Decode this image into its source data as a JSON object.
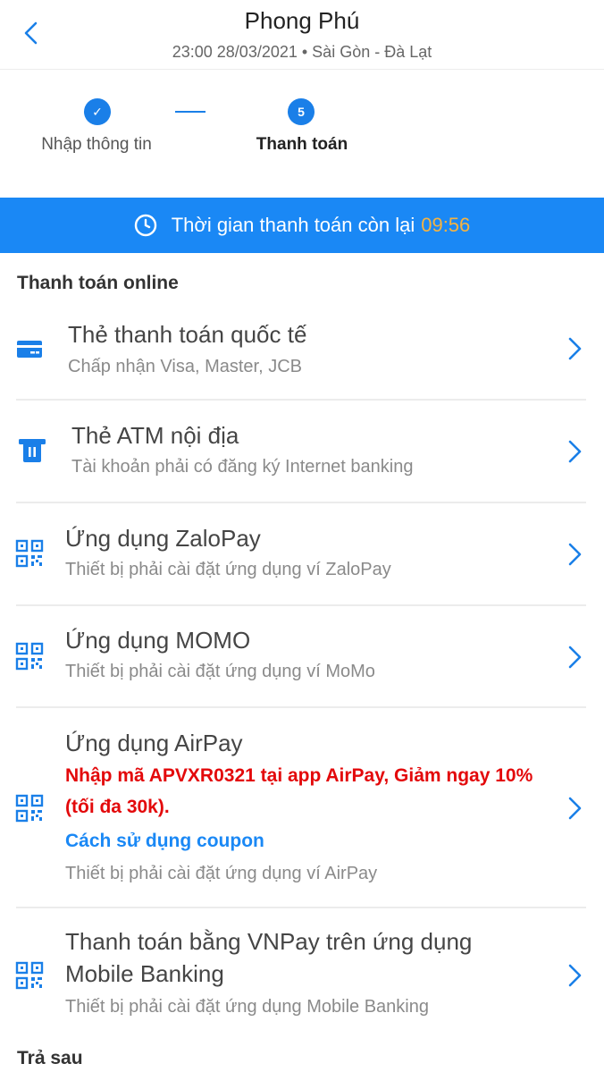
{
  "header": {
    "title": "Phong Phú",
    "subtitle": "23:00 28/03/2021 • Sài Gòn - Đà Lạt"
  },
  "stepper": {
    "steps": [
      {
        "label": "Nhập thông tin",
        "marker": "✓",
        "state": "done"
      },
      {
        "label": "Thanh toán",
        "marker": "5",
        "state": "active"
      }
    ]
  },
  "countdown": {
    "label": "Thời gian thanh toán còn lại",
    "time": "09:56"
  },
  "sections": {
    "online": "Thanh toán online",
    "later": "Trả sau"
  },
  "methods": [
    {
      "icon": "credit-card-icon",
      "title": "Thẻ thanh toán quốc tế",
      "subtitle": "Chấp nhận Visa, Master, JCB"
    },
    {
      "icon": "atm-card-icon",
      "title": "Thẻ ATM nội địa",
      "subtitle": "Tài khoản phải có đăng ký Internet banking"
    },
    {
      "icon": "qr-code-icon",
      "title": "Ứng dụng ZaloPay",
      "subtitle": "Thiết bị phải cài đặt ứng dụng ví ZaloPay"
    },
    {
      "icon": "qr-code-icon",
      "title": "Ứng dụng MOMO",
      "subtitle": "Thiết bị phải cài đặt ứng dụng ví MoMo"
    },
    {
      "icon": "qr-code-icon",
      "title": "Ứng dụng AirPay",
      "promo_line1": "Nhập mã APVXR0321 tại app AirPay, Giảm ngay 10%",
      "promo_line2": "(tối đa 30k).",
      "coupon_link": "Cách sử dụng coupon",
      "subtitle": "Thiết bị phải cài đặt ứng dụng ví AirPay"
    },
    {
      "icon": "qr-code-icon",
      "title_line1": "Thanh toán bằng VNPay trên ứng dụng",
      "title_line2": "Mobile Banking",
      "subtitle": "Thiết bị phải cài đặt ứng dụng Mobile Banking"
    }
  ],
  "colors": {
    "accent": "#1a88f5",
    "timer": "#f5b341",
    "promo": "#e3090b"
  }
}
